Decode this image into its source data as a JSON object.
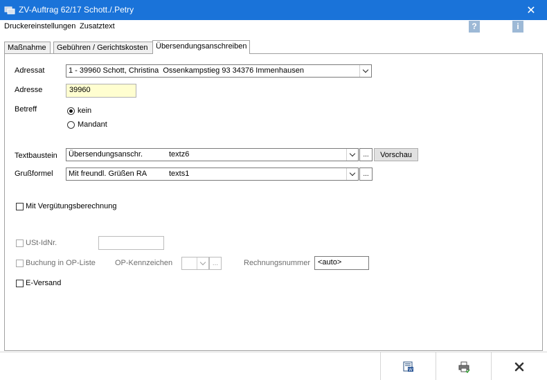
{
  "window": {
    "title": "ZV-Auftrag  62/17 Schott./.Petry",
    "close_glyph": "✕"
  },
  "menu": {
    "items": [
      "Druckereinstellungen",
      "Zusatztext"
    ],
    "help_glyph": "?",
    "info_glyph": "i"
  },
  "tabs": [
    "Maßnahme",
    "Gebühren / Gerichtskosten",
    "Übersendungsanschreiben"
  ],
  "form": {
    "adressat_label": "Adressat",
    "adressat_value": "1 - 39960 Schott, Christina  Ossenkampstieg 93 34376 Immenhausen",
    "adresse_label": "Adresse",
    "adresse_value": "39960",
    "betreff_label": "Betreff",
    "betreff_options": [
      "kein",
      "Mandant"
    ],
    "textbaustein_label": "Textbaustein",
    "textbaustein_name": "Übersendungsanschr.",
    "textbaustein_code": "textz6",
    "vorschau_label": "Vorschau",
    "grussformel_label": "Grußformel",
    "grussformel_name": "Mit freundl. Grüßen RA",
    "grussformel_code": "texts1",
    "ellipsis": "...",
    "verguetung_label": "Mit Vergütungsberechnung",
    "ustid_label": "USt-IdNr.",
    "ustid_value": "",
    "buchung_label": "Buchung in OP-Liste",
    "op_kennzeichen_label": "OP-Kennzeichen",
    "rechnungsnummer_label": "Rechnungsnummer",
    "rechnungsnummer_value": "<auto>",
    "eversand_label": "E-Versand"
  },
  "bottom_buttons": [
    "word-export-icon",
    "print-icon",
    "close-icon"
  ],
  "colors": {
    "titlebar": "#1a73d9",
    "yellow_field": "#fffed0",
    "help_icon": "#9db9d6"
  }
}
